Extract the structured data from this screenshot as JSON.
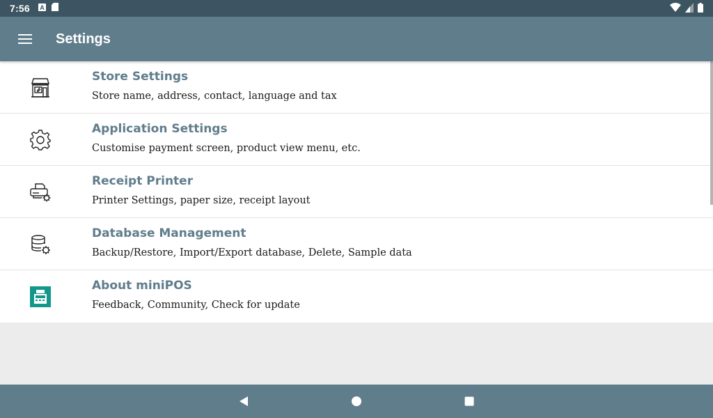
{
  "status_bar": {
    "time": "7:56",
    "left_icons": [
      "a-notification-icon",
      "sd-card-icon"
    ],
    "right_icons": [
      "wifi-icon",
      "signal-icon",
      "battery-icon"
    ]
  },
  "app_bar": {
    "menu_icon": "hamburger-menu-icon",
    "title": "Settings",
    "color": "#607d8b"
  },
  "settings": {
    "items": [
      {
        "icon": "store-icon",
        "title": "Store Settings",
        "subtitle": "Store name, address, contact, language and tax"
      },
      {
        "icon": "gear-icon",
        "title": "Application Settings",
        "subtitle": "Customise payment screen, product view menu, etc."
      },
      {
        "icon": "printer-icon",
        "title": "Receipt Printer",
        "subtitle": "Printer Settings, paper size, receipt layout"
      },
      {
        "icon": "database-icon",
        "title": "Database Management",
        "subtitle": "Backup/Restore, Import/Export database, Delete, Sample data"
      },
      {
        "icon": "minipos-app-icon",
        "title": "About miniPOS",
        "subtitle": "Feedback, Community, Check for update"
      }
    ]
  },
  "nav_bar": {
    "buttons": [
      "back-icon",
      "home-icon",
      "recents-icon"
    ]
  }
}
